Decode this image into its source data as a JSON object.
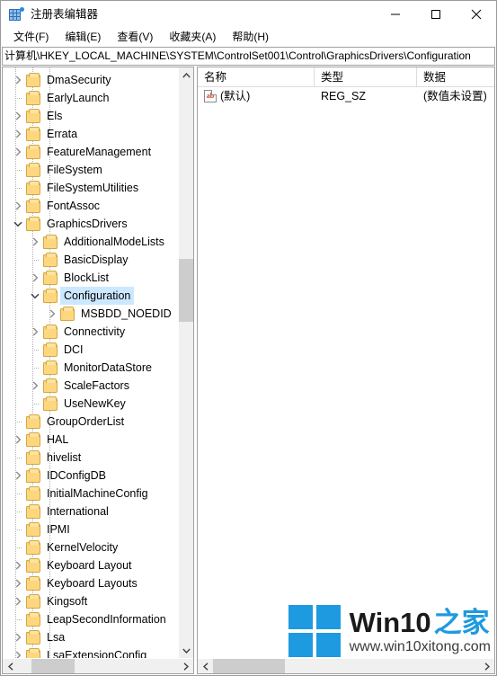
{
  "window": {
    "title": "注册表编辑器",
    "icon": "registry-editor-icon",
    "minimize_label": "最小化",
    "maximize_label": "最大化",
    "close_label": "关闭"
  },
  "menu": {
    "items": [
      {
        "label": "文件(F)"
      },
      {
        "label": "编辑(E)"
      },
      {
        "label": "查看(V)"
      },
      {
        "label": "收藏夹(A)"
      },
      {
        "label": "帮助(H)"
      }
    ]
  },
  "address": {
    "path": "计算机\\HKEY_LOCAL_MACHINE\\SYSTEM\\ControlSet001\\Control\\GraphicsDrivers\\Configuration"
  },
  "tree": {
    "items": [
      {
        "label": "DmaSecurity",
        "depth": 1,
        "chevron": "collapsed",
        "selected": false
      },
      {
        "label": "EarlyLaunch",
        "depth": 1,
        "chevron": "none",
        "selected": false
      },
      {
        "label": "Els",
        "depth": 1,
        "chevron": "collapsed",
        "selected": false
      },
      {
        "label": "Errata",
        "depth": 1,
        "chevron": "collapsed",
        "selected": false
      },
      {
        "label": "FeatureManagement",
        "depth": 1,
        "chevron": "collapsed",
        "selected": false
      },
      {
        "label": "FileSystem",
        "depth": 1,
        "chevron": "none",
        "selected": false
      },
      {
        "label": "FileSystemUtilities",
        "depth": 1,
        "chevron": "none",
        "selected": false
      },
      {
        "label": "FontAssoc",
        "depth": 1,
        "chevron": "collapsed",
        "selected": false
      },
      {
        "label": "GraphicsDrivers",
        "depth": 1,
        "chevron": "expanded",
        "selected": false
      },
      {
        "label": "AdditionalModeLists",
        "depth": 2,
        "chevron": "collapsed",
        "selected": false
      },
      {
        "label": "BasicDisplay",
        "depth": 2,
        "chevron": "none",
        "selected": false
      },
      {
        "label": "BlockList",
        "depth": 2,
        "chevron": "collapsed",
        "selected": false
      },
      {
        "label": "Configuration",
        "depth": 2,
        "chevron": "expanded",
        "selected": true
      },
      {
        "label": "MSBDD_NOEDID",
        "depth": 3,
        "chevron": "collapsed",
        "selected": false
      },
      {
        "label": "Connectivity",
        "depth": 2,
        "chevron": "collapsed",
        "selected": false
      },
      {
        "label": "DCI",
        "depth": 2,
        "chevron": "none",
        "selected": false
      },
      {
        "label": "MonitorDataStore",
        "depth": 2,
        "chevron": "none",
        "selected": false
      },
      {
        "label": "ScaleFactors",
        "depth": 2,
        "chevron": "collapsed",
        "selected": false
      },
      {
        "label": "UseNewKey",
        "depth": 2,
        "chevron": "none",
        "selected": false
      },
      {
        "label": "GroupOrderList",
        "depth": 1,
        "chevron": "none",
        "selected": false
      },
      {
        "label": "HAL",
        "depth": 1,
        "chevron": "collapsed",
        "selected": false
      },
      {
        "label": "hivelist",
        "depth": 1,
        "chevron": "none",
        "selected": false
      },
      {
        "label": "IDConfigDB",
        "depth": 1,
        "chevron": "collapsed",
        "selected": false
      },
      {
        "label": "InitialMachineConfig",
        "depth": 1,
        "chevron": "none",
        "selected": false
      },
      {
        "label": "International",
        "depth": 1,
        "chevron": "none",
        "selected": false
      },
      {
        "label": "IPMI",
        "depth": 1,
        "chevron": "none",
        "selected": false
      },
      {
        "label": "KernelVelocity",
        "depth": 1,
        "chevron": "none",
        "selected": false
      },
      {
        "label": "Keyboard Layout",
        "depth": 1,
        "chevron": "collapsed",
        "selected": false
      },
      {
        "label": "Keyboard Layouts",
        "depth": 1,
        "chevron": "collapsed",
        "selected": false
      },
      {
        "label": "Kingsoft",
        "depth": 1,
        "chevron": "collapsed",
        "selected": false
      },
      {
        "label": "LeapSecondInformation",
        "depth": 1,
        "chevron": "none",
        "selected": false
      },
      {
        "label": "Lsa",
        "depth": 1,
        "chevron": "collapsed",
        "selected": false
      },
      {
        "label": "LsaExtensionConfig",
        "depth": 1,
        "chevron": "collapsed",
        "selected": false
      }
    ]
  },
  "list": {
    "columns": [
      {
        "label": "名称"
      },
      {
        "label": "类型"
      },
      {
        "label": "数据"
      }
    ],
    "rows": [
      {
        "icon": "string-value-icon",
        "name": "(默认)",
        "type": "REG_SZ",
        "data": "(数值未设置)"
      }
    ]
  },
  "watermark": {
    "brand_en": "Win10",
    "brand_cn": "之家",
    "url": "www.win10xitong.com",
    "logo_color": "#1e9ae0"
  },
  "colors": {
    "selection": "#cce8ff",
    "folder": "#fcd77f",
    "folder_border": "#d6a740",
    "scrollbar_thumb": "#cdcdcd",
    "scrollbar_track": "#f0f0f0",
    "window_border": "#9b9b9b"
  }
}
